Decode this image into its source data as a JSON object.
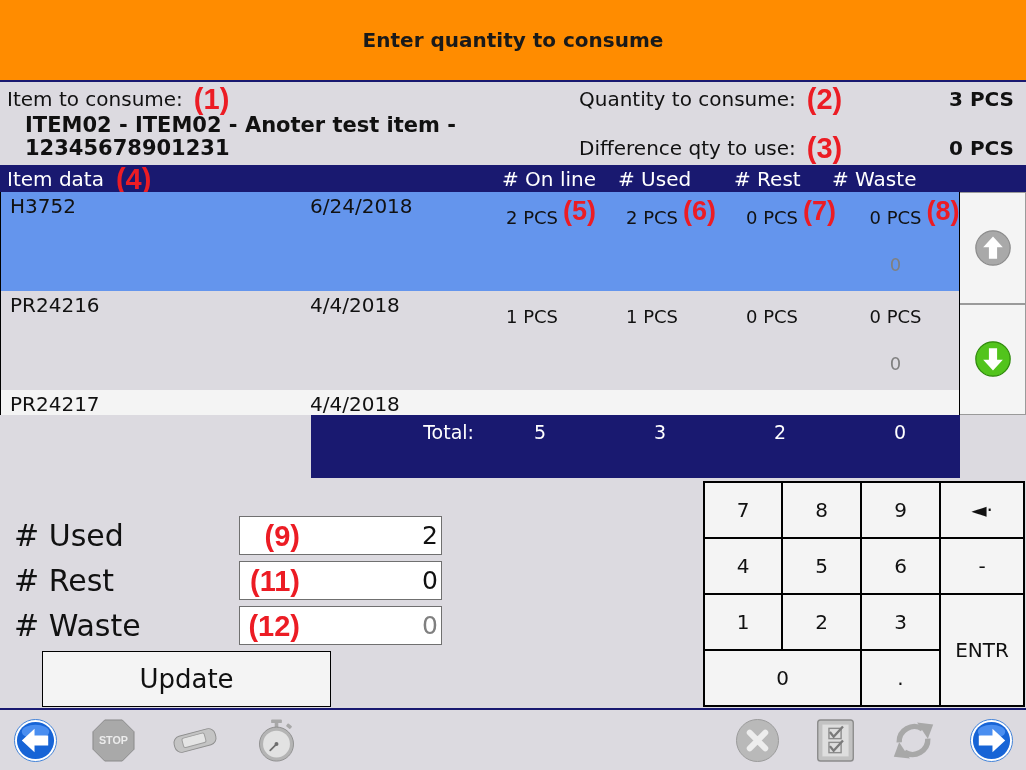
{
  "header": {
    "title": "Enter quantity to consume"
  },
  "item": {
    "label": "Item to consume:",
    "marker": "(1)",
    "name": "ITEM02 - ITEM02 - Anoter test item - 12345678901231"
  },
  "quantities": [
    {
      "label": "Quantity to consume:",
      "marker": "(2)",
      "value": "3 PCS"
    },
    {
      "label": "Difference qty to use:",
      "marker": "(3)",
      "value": "0 PCS"
    }
  ],
  "table": {
    "columns": [
      {
        "label": "Item data",
        "marker": "(4)"
      },
      {
        "label": "# On line"
      },
      {
        "label": "# Used"
      },
      {
        "label": "# Rest"
      },
      {
        "label": "# Waste"
      }
    ],
    "rows": [
      {
        "name": "H3752",
        "date": "6/24/2018",
        "values": [
          "2 PCS",
          "2 PCS",
          "0 PCS",
          "0 PCS"
        ],
        "markers": [
          "(5)",
          "(6)",
          "(7)",
          "(8)"
        ],
        "waste_entry": "0",
        "selected": true
      },
      {
        "name": "PR24216",
        "date": "4/4/2018",
        "values": [
          "1 PCS",
          "1 PCS",
          "0 PCS",
          "0 PCS"
        ],
        "waste_entry": "0",
        "selected": false
      },
      {
        "name": "PR24217",
        "date": "4/4/2018",
        "selected": false
      }
    ],
    "scroll_buttons": [
      {
        "kind": "up",
        "disabled": true
      },
      {
        "kind": "down",
        "disabled": false
      }
    ],
    "totals": {
      "label": "Total:",
      "values": [
        "5",
        "3",
        "2",
        "0"
      ]
    }
  },
  "form": {
    "fields": [
      {
        "label": "# Used",
        "marker": "(9)",
        "value": "2"
      },
      {
        "label": "# Rest",
        "marker": "(11)",
        "value": "0"
      },
      {
        "label": "# Waste",
        "marker": "(12)",
        "placeholder": "0"
      }
    ],
    "update_button": "Update"
  },
  "keypad": [
    {
      "label": "7",
      "kind": "key"
    },
    {
      "label": "8",
      "kind": "key"
    },
    {
      "label": "9",
      "kind": "key"
    },
    {
      "label": "◄·",
      "kind": "key"
    },
    {
      "label": "4",
      "kind": "key"
    },
    {
      "label": "5",
      "kind": "key"
    },
    {
      "label": "6",
      "kind": "key"
    },
    {
      "label": "-",
      "kind": "key"
    },
    {
      "label": "1",
      "kind": "key"
    },
    {
      "label": "2",
      "kind": "key"
    },
    {
      "label": "3",
      "kind": "key"
    },
    {
      "label": "ENTR",
      "kind": "tall"
    },
    {
      "label": "0",
      "kind": "wide"
    },
    {
      "label": ".",
      "kind": "key"
    }
  ],
  "toolbar": {
    "left": [
      {
        "kind": "back",
        "disabled": false
      },
      {
        "kind": "stop",
        "label": "STOP",
        "disabled": true
      },
      {
        "kind": "tablet",
        "disabled": true
      },
      {
        "kind": "stopwatch",
        "disabled": true
      }
    ],
    "right": [
      {
        "kind": "cancel",
        "disabled": true
      },
      {
        "kind": "checklist",
        "disabled": true
      },
      {
        "kind": "refresh",
        "disabled": true
      },
      {
        "kind": "forward",
        "disabled": false
      }
    ]
  }
}
